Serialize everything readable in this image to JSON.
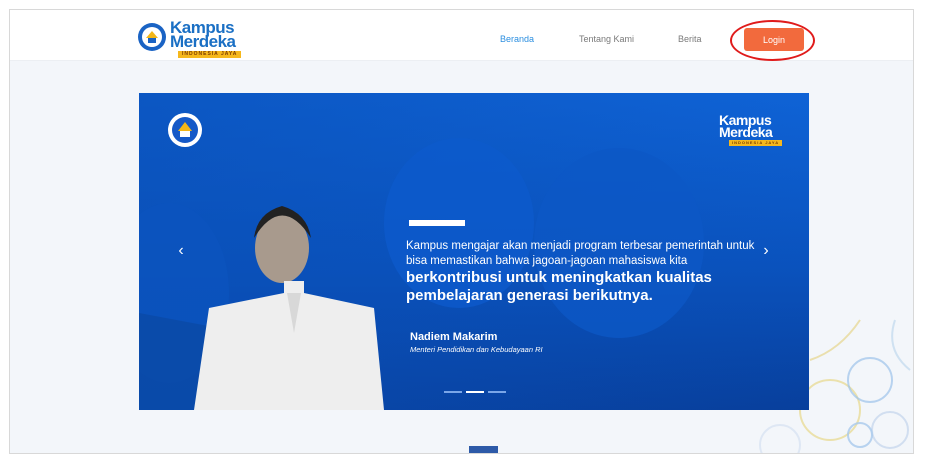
{
  "header": {
    "logo": {
      "line1": "Kampus",
      "line2": "Merdeka",
      "ribbon": "INDONESIA JAYA"
    },
    "nav": [
      {
        "label": "Beranda",
        "active": true
      },
      {
        "label": "Tentang Kami",
        "active": false
      },
      {
        "label": "Berita",
        "active": false
      }
    ],
    "login_label": "Login"
  },
  "hero": {
    "logo": {
      "line1": "Kampus",
      "line2": "Merdeka",
      "ribbon": "INDONESIA JAYA"
    },
    "quote_normal": "Kampus mengajar akan menjadi program terbesar pemerintah untuk bisa memastikan bahwa jagoan-jagoan mahasiswa kita",
    "quote_bold": "berkontribusi untuk meningkatkan kualitas pembelajaran generasi berikutnya.",
    "speaker_name": "Nadiem Makarim",
    "speaker_role": "Menteri Pendidikan dan Kebudayaan RI",
    "prev_icon": "‹",
    "next_icon": "›",
    "slides_total": 3,
    "active_slide": 2
  },
  "colors": {
    "brand_blue": "#1a6fc4",
    "nav_active": "#2c8fe0",
    "login_orange": "#f26a3d",
    "highlight_red": "#e01b1b",
    "hero_blue": "#0f63d6"
  }
}
